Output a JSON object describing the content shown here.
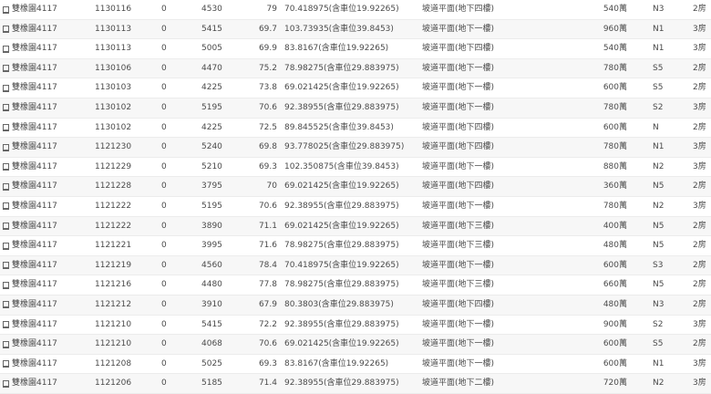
{
  "icon": "building-icon",
  "rows": [
    {
      "name": "雙橡園4117",
      "date": "1130116",
      "zero": "0",
      "total": "4530",
      "unit": "79",
      "area": "70.418975(含車位19.92265)",
      "parking": "坡道平面(地下四樓)",
      "price": "540萬",
      "floor": "N3",
      "type": "2房"
    },
    {
      "name": "雙橡園4117",
      "date": "1130113",
      "zero": "0",
      "total": "5415",
      "unit": "69.7",
      "area": "103.73935(含車位39.8453)",
      "parking": "坡道平面(地下一樓)",
      "price": "960萬",
      "floor": "N1",
      "type": "3房"
    },
    {
      "name": "雙橡園4117",
      "date": "1130113",
      "zero": "0",
      "total": "5005",
      "unit": "69.9",
      "area": "83.8167(含車位19.92265)",
      "parking": "坡道平面(地下四樓)",
      "price": "540萬",
      "floor": "N1",
      "type": "3房"
    },
    {
      "name": "雙橡園4117",
      "date": "1130106",
      "zero": "0",
      "total": "4470",
      "unit": "75.2",
      "area": "78.98275(含車位29.883975)",
      "parking": "坡道平面(地下一樓)",
      "price": "780萬",
      "floor": "S5",
      "type": "2房"
    },
    {
      "name": "雙橡園4117",
      "date": "1130103",
      "zero": "0",
      "total": "4225",
      "unit": "73.8",
      "area": "69.021425(含車位19.92265)",
      "parking": "坡道平面(地下一樓)",
      "price": "600萬",
      "floor": "S5",
      "type": "2房"
    },
    {
      "name": "雙橡園4117",
      "date": "1130102",
      "zero": "0",
      "total": "5195",
      "unit": "70.6",
      "area": "92.38955(含車位29.883975)",
      "parking": "坡道平面(地下一樓)",
      "price": "780萬",
      "floor": "S2",
      "type": "3房"
    },
    {
      "name": "雙橡園4117",
      "date": "1130102",
      "zero": "0",
      "total": "4225",
      "unit": "72.5",
      "area": "89.845525(含車位39.8453)",
      "parking": "坡道平面(地下四樓)",
      "price": "600萬",
      "floor": "N",
      "type": "2房"
    },
    {
      "name": "雙橡園4117",
      "date": "1121230",
      "zero": "0",
      "total": "5240",
      "unit": "69.8",
      "area": "93.778025(含車位29.883975)",
      "parking": "坡道平面(地下四樓)",
      "price": "780萬",
      "floor": "N1",
      "type": "3房"
    },
    {
      "name": "雙橡園4117",
      "date": "1121229",
      "zero": "0",
      "total": "5210",
      "unit": "69.3",
      "area": "102.350875(含車位39.8453)",
      "parking": "坡道平面(地下一樓)",
      "price": "880萬",
      "floor": "N2",
      "type": "3房"
    },
    {
      "name": "雙橡園4117",
      "date": "1121228",
      "zero": "0",
      "total": "3795",
      "unit": "70",
      "area": "69.021425(含車位19.92265)",
      "parking": "坡道平面(地下四樓)",
      "price": "360萬",
      "floor": "N5",
      "type": "2房"
    },
    {
      "name": "雙橡園4117",
      "date": "1121222",
      "zero": "0",
      "total": "5195",
      "unit": "70.6",
      "area": "92.38955(含車位29.883975)",
      "parking": "坡道平面(地下一樓)",
      "price": "780萬",
      "floor": "N2",
      "type": "3房"
    },
    {
      "name": "雙橡園4117",
      "date": "1121222",
      "zero": "0",
      "total": "3890",
      "unit": "71.1",
      "area": "69.021425(含車位19.92265)",
      "parking": "坡道平面(地下三樓)",
      "price": "400萬",
      "floor": "N5",
      "type": "2房"
    },
    {
      "name": "雙橡園4117",
      "date": "1121221",
      "zero": "0",
      "total": "3995",
      "unit": "71.6",
      "area": "78.98275(含車位29.883975)",
      "parking": "坡道平面(地下三樓)",
      "price": "480萬",
      "floor": "N5",
      "type": "2房"
    },
    {
      "name": "雙橡園4117",
      "date": "1121219",
      "zero": "0",
      "total": "4560",
      "unit": "78.4",
      "area": "70.418975(含車位19.92265)",
      "parking": "坡道平面(地下一樓)",
      "price": "600萬",
      "floor": "S3",
      "type": "2房"
    },
    {
      "name": "雙橡園4117",
      "date": "1121216",
      "zero": "0",
      "total": "4480",
      "unit": "77.8",
      "area": "78.98275(含車位29.883975)",
      "parking": "坡道平面(地下三樓)",
      "price": "660萬",
      "floor": "N5",
      "type": "2房"
    },
    {
      "name": "雙橡園4117",
      "date": "1121212",
      "zero": "0",
      "total": "3910",
      "unit": "67.9",
      "area": "80.3803(含車位29.883975)",
      "parking": "坡道平面(地下四樓)",
      "price": "480萬",
      "floor": "N3",
      "type": "2房"
    },
    {
      "name": "雙橡園4117",
      "date": "1121210",
      "zero": "0",
      "total": "5415",
      "unit": "72.2",
      "area": "92.38955(含車位29.883975)",
      "parking": "坡道平面(地下一樓)",
      "price": "900萬",
      "floor": "S2",
      "type": "3房"
    },
    {
      "name": "雙橡園4117",
      "date": "1121210",
      "zero": "0",
      "total": "4068",
      "unit": "70.6",
      "area": "69.021425(含車位19.92265)",
      "parking": "坡道平面(地下一樓)",
      "price": "600萬",
      "floor": "S5",
      "type": "2房"
    },
    {
      "name": "雙橡園4117",
      "date": "1121208",
      "zero": "0",
      "total": "5025",
      "unit": "69.3",
      "area": "83.8167(含車位19.92265)",
      "parking": "坡道平面(地下一樓)",
      "price": "600萬",
      "floor": "N1",
      "type": "3房"
    },
    {
      "name": "雙橡園4117",
      "date": "1121206",
      "zero": "0",
      "total": "5185",
      "unit": "71.4",
      "area": "92.38955(含車位29.883975)",
      "parking": "坡道平面(地下二樓)",
      "price": "720萬",
      "floor": "N2",
      "type": "3房"
    }
  ]
}
